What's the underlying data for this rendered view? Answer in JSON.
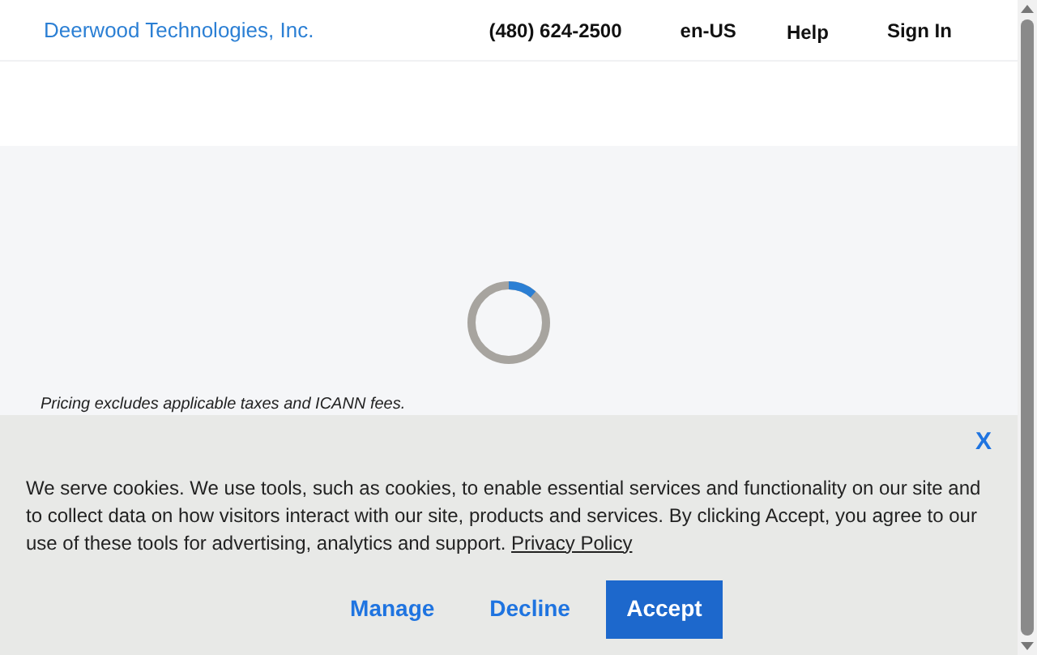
{
  "header": {
    "brand": "Deerwood Technologies, Inc.",
    "phone": "(480) 624-2500",
    "locale": "en-US",
    "help": "Help",
    "sign_in": "Sign In"
  },
  "main": {
    "note": "Pricing excludes applicable taxes and ICANN fees."
  },
  "cookie_banner": {
    "close": "X",
    "text": "We serve cookies. We use tools, such as cookies, to enable essential services and functionality on our site and to collect data on how visitors interact with our site, products and services. By clicking Accept, you agree to our use of these tools for advertising, analytics and support.",
    "link": "Privacy Policy",
    "buttons": [
      {
        "label": "Manage",
        "kind": "link"
      },
      {
        "label": "Decline",
        "kind": "link"
      },
      {
        "label": "Accept",
        "kind": "primary"
      }
    ]
  }
}
